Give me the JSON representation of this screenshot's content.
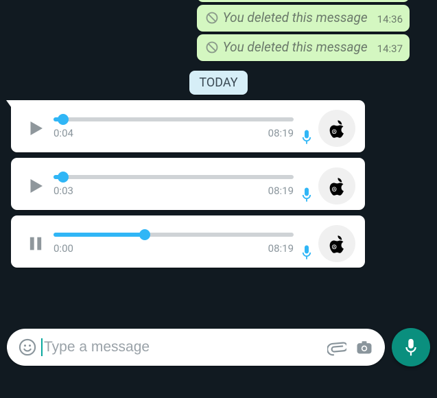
{
  "deleted": {
    "text": "You deleted this message",
    "items": [
      {
        "time": "14:36"
      },
      {
        "time": "14:37"
      }
    ]
  },
  "date_chip": "TODAY",
  "voice": [
    {
      "state": "play",
      "elapsed": "0:04",
      "time": "08:19",
      "progress": 4
    },
    {
      "state": "play",
      "elapsed": "0:03",
      "time": "08:19",
      "progress": 4
    },
    {
      "state": "pause",
      "elapsed": "0:00",
      "time": "08:19",
      "progress": 38
    }
  ],
  "composer": {
    "placeholder": "Type a message"
  },
  "colors": {
    "accent": "#30b6f6",
    "fab": "#0a8f7e",
    "outgoing": "#d4f7c1"
  }
}
